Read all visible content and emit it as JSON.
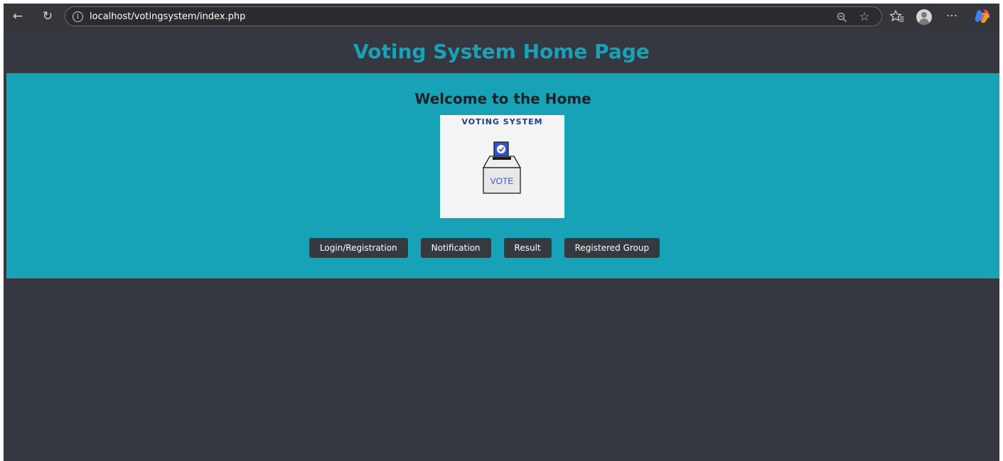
{
  "browser": {
    "url": "localhost/votingsystem/index.php",
    "icons": {
      "back": "arrow-left-icon",
      "reload": "reload-icon",
      "info": "info-icon",
      "zoom": "zoom-out-icon",
      "star": "star-icon",
      "favorites": "favorites-icon",
      "profile": "profile-icon",
      "more": "more-icon",
      "copilot": "copilot-icon"
    }
  },
  "page": {
    "title": "Voting System Home Page",
    "colors": {
      "accent": "#17a2b8",
      "background": "#353840",
      "button": "#343a40"
    }
  },
  "hero": {
    "heading": "Welcome to the Home",
    "image": {
      "caption": "VOTING SYSTEM",
      "box_label": "VOTE"
    },
    "buttons": [
      {
        "label": "Login/Registration"
      },
      {
        "label": "Notification"
      },
      {
        "label": "Result"
      },
      {
        "label": "Registered Group"
      }
    ]
  }
}
